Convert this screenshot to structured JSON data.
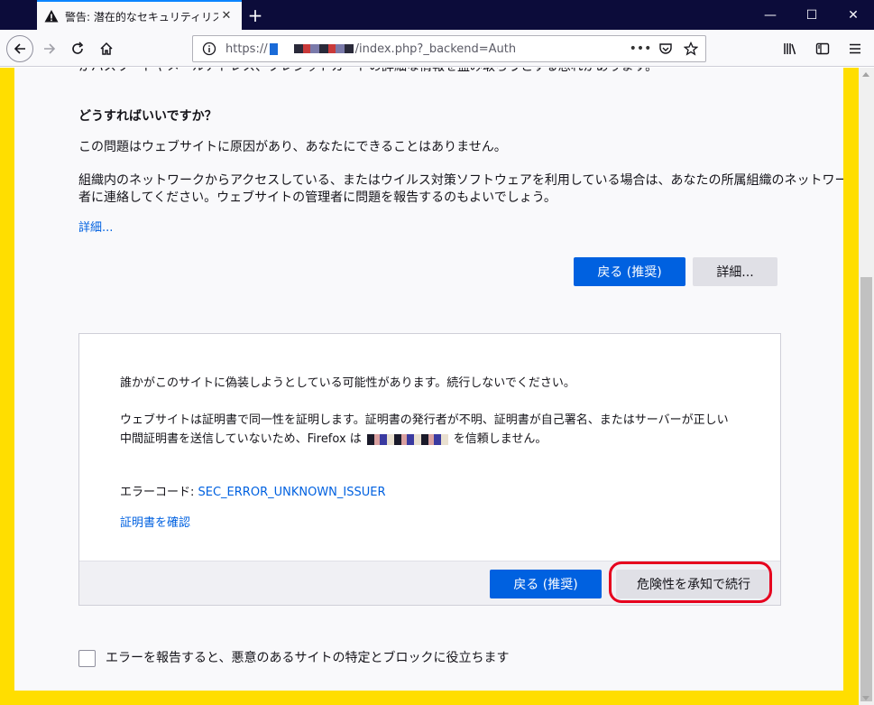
{
  "browser": {
    "tab": {
      "title": "警告: 潜在的なセキュリティリスクあ",
      "close_glyph": "✕"
    },
    "new_tab_glyph": "+",
    "window_controls": {
      "minimize": "—",
      "maximize": "☐",
      "close": "✕"
    },
    "url": {
      "scheme": "https://",
      "path": "/index.php?_backend=Auth"
    },
    "icons": [
      "back-icon",
      "forward-icon",
      "reload-icon",
      "home-icon",
      "info-icon",
      "page-actions-icon",
      "pocket-icon",
      "bookmark-star-icon",
      "library-icon",
      "sidebar-icon",
      "menu-icon"
    ]
  },
  "page": {
    "cut_line": "かパスワードやメールアドレス、クレジットカードの詳細な情報を盗み取ろうとする恐れがあります。",
    "what_heading": "どうすればいいですか？",
    "p1": "この問題はウェブサイトに原因があり、あなたにできることはありません。",
    "p2a": "組織内のネットワークからアクセスしている、またはウイルス対策ソフトウェアを利用している場合は、あなたの所属組織のネットワーク管理",
    "p2b": "者に連絡してください。ウェブサイトの管理者に問題を報告するのもよいでしょう。",
    "details_link": "詳細...",
    "back_button": "戻る (推奨)",
    "advanced_button": "詳細..."
  },
  "panel": {
    "line1": "誰かがこのサイトに偽装しようとしている可能性があります。続行しないでください。",
    "line2": "ウェブサイトは証明書で同一性を証明します。証明書の発行者が不明、証明書が自己署名、またはサーバーが正しい",
    "line3_pre": "中間証明書を送信していないため、Firefox は",
    "line3_post": "を信頼しません。",
    "error_label": "エラーコード: ",
    "error_code": "SEC_ERROR_UNKNOWN_ISSUER",
    "view_cert": "証明書を確認",
    "back_button": "戻る (推奨)",
    "accept_button": "危険性を承知で続行"
  },
  "report": {
    "label": "エラーを報告すると、悪意のあるサイトの特定とブロックに役立ちます"
  },
  "colors": {
    "accent": "#0061e0",
    "frame_border": "#ffde00",
    "highlight": "#e6001e",
    "titlebar": "#0c0c3a"
  }
}
